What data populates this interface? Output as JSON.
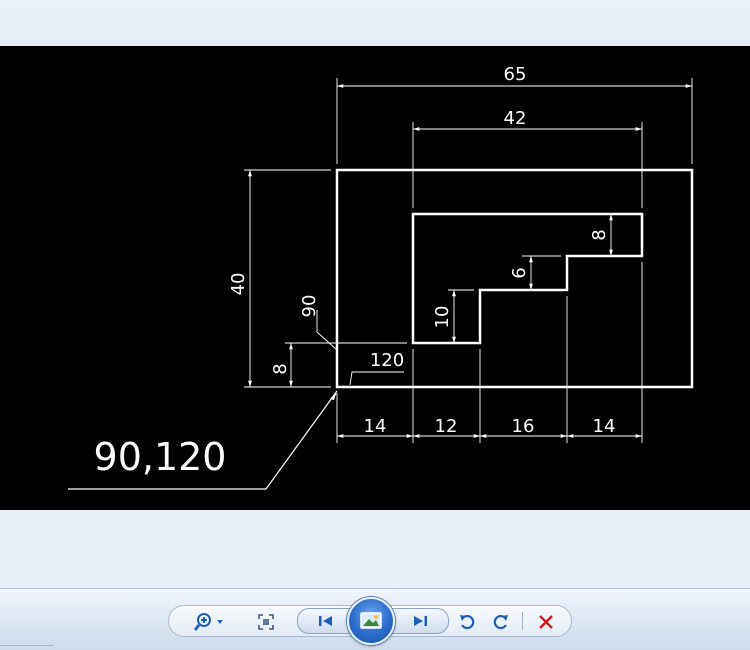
{
  "drawing": {
    "dims": {
      "overall_width": "65",
      "inner_width": "42",
      "overall_height": "40",
      "step_top": "8",
      "step_mid": "6",
      "step_low": "10",
      "offset_height": "8",
      "angle": "90",
      "length_label": "120",
      "bottom_1": "14",
      "bottom_2": "12",
      "bottom_3": "16",
      "bottom_4": "14"
    },
    "coordinate_label": "90,120",
    "colors": {
      "background": "#000000",
      "lines": "#ffffff"
    }
  },
  "toolbar": {
    "buttons": [
      {
        "name": "zoom-button",
        "icon": "magnifier-plus-icon"
      },
      {
        "name": "actual-size-button",
        "icon": "fit-window-icon"
      },
      {
        "name": "previous-button",
        "icon": "skip-previous-icon"
      },
      {
        "name": "slideshow-button",
        "icon": "slideshow-icon"
      },
      {
        "name": "next-button",
        "icon": "skip-next-icon"
      },
      {
        "name": "rotate-counterclockwise-button",
        "icon": "rotate-left-icon"
      },
      {
        "name": "rotate-clockwise-button",
        "icon": "rotate-right-icon"
      },
      {
        "name": "delete-button",
        "icon": "close-x-icon"
      }
    ],
    "colors": {
      "icon_blue": "#1f5fb8",
      "delete_red": "#d01c1c"
    }
  }
}
